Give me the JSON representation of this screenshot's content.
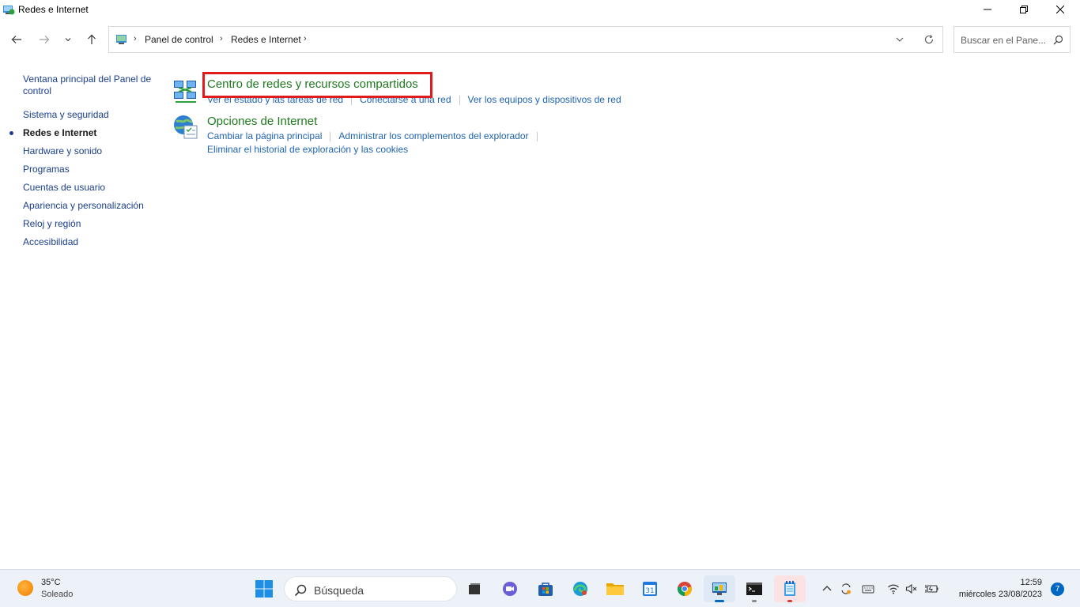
{
  "window": {
    "title": "Redes e Internet"
  },
  "address": {
    "crumbs": [
      "Panel de control",
      "Redes e Internet"
    ],
    "separator": "›"
  },
  "search": {
    "placeholder": "Buscar en el Pane..."
  },
  "sidebar": {
    "items": [
      {
        "label": "Ventana principal del Panel de control"
      },
      {
        "label": "Sistema y seguridad"
      },
      {
        "label": "Redes e Internet"
      },
      {
        "label": "Hardware y sonido"
      },
      {
        "label": "Programas"
      },
      {
        "label": "Cuentas de usuario"
      },
      {
        "label": "Apariencia y personalización"
      },
      {
        "label": "Reloj y región"
      },
      {
        "label": "Accesibilidad"
      }
    ]
  },
  "categories": [
    {
      "title": "Centro de redes y recursos compartidos",
      "links": [
        "Ver el estado y las tareas de red",
        "Conectarse a una red",
        "Ver los equipos y dispositivos de red"
      ]
    },
    {
      "title": "Opciones de Internet",
      "links": [
        "Cambiar la página principal",
        "Administrar los complementos del explorador",
        "Eliminar el historial de exploración y las cookies"
      ]
    }
  ],
  "taskbar": {
    "weather_temp": "35°C",
    "weather_condition": "Soleado",
    "search_label": "Búsqueda",
    "clock_time": "12:59",
    "clock_date": "miércoles 23/08/2023",
    "notification_count": "7",
    "accent_color": "#0067c0"
  },
  "colors": {
    "category_title": "#1e7a1e",
    "link": "#1e63b4",
    "highlight": "#e11b1b"
  }
}
